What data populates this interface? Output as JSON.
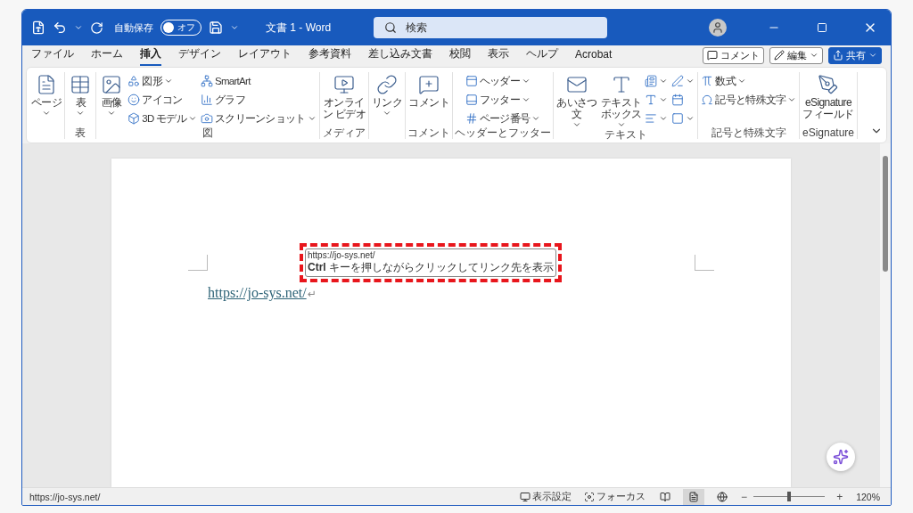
{
  "window": {
    "title": "文書 1 - Word",
    "autosave": {
      "label": "自動保存",
      "on": false,
      "state_text": "オフ"
    },
    "search": {
      "placeholder": "検索"
    }
  },
  "menu_tabs": [
    {
      "label": "ファイル",
      "selected": false
    },
    {
      "label": "ホーム",
      "selected": false
    },
    {
      "label": "挿入",
      "selected": true
    },
    {
      "label": "デザイン",
      "selected": false
    },
    {
      "label": "レイアウト",
      "selected": false
    },
    {
      "label": "参考資料",
      "selected": false
    },
    {
      "label": "差し込み文書",
      "selected": false
    },
    {
      "label": "校閲",
      "selected": false
    },
    {
      "label": "表示",
      "selected": false
    },
    {
      "label": "ヘルプ",
      "selected": false
    },
    {
      "label": "Acrobat",
      "selected": false
    }
  ],
  "action_buttons": [
    {
      "label": "コメント",
      "kind": "outline",
      "dropdown": false
    },
    {
      "label": "編集",
      "kind": "outline",
      "dropdown": true
    },
    {
      "label": "共有",
      "kind": "primary",
      "dropdown": true
    }
  ],
  "ribbon": {
    "groups": [
      {
        "columns": [
          [
            {
              "kind": "large",
              "label": "ページ",
              "dropdown": true
            }
          ]
        ]
      },
      {
        "label": "表",
        "columns": [
          [
            {
              "kind": "large",
              "label": "表",
              "dropdown": true
            }
          ]
        ]
      },
      {
        "label": "図",
        "columns": [
          [
            {
              "kind": "large",
              "label": "画像",
              "dropdown": true
            }
          ],
          [
            {
              "kind": "small",
              "label": "図形",
              "dropdown": true
            },
            {
              "kind": "small",
              "label": "アイコン",
              "dropdown": false
            },
            {
              "kind": "small",
              "label": "3D モデル",
              "dropdown": true
            }
          ],
          [
            {
              "kind": "small",
              "label": "SmartArt",
              "dropdown": false
            },
            {
              "kind": "small",
              "label": "グラフ",
              "dropdown": false
            },
            {
              "kind": "small",
              "label": "スクリーンショット",
              "dropdown": true
            }
          ]
        ]
      },
      {
        "label": "メディア",
        "columns": [
          [
            {
              "kind": "large",
              "lines": [
                "オンライ",
                "ン ビデオ"
              ],
              "dropdown": false
            }
          ]
        ]
      },
      {
        "columns": [
          [
            {
              "kind": "large",
              "label": "リンク",
              "dropdown": true
            }
          ]
        ]
      },
      {
        "label": "コメント",
        "columns": [
          [
            {
              "kind": "large",
              "label": "コメント",
              "dropdown": false
            }
          ]
        ]
      },
      {
        "label": "ヘッダーとフッター",
        "columns": [
          [
            {
              "kind": "small",
              "label": "ヘッダー",
              "dropdown": true
            },
            {
              "kind": "small",
              "label": "フッター",
              "dropdown": true
            },
            {
              "kind": "small",
              "label": "ページ番号",
              "dropdown": true
            }
          ]
        ]
      },
      {
        "label": "テキスト",
        "columns": [
          [
            {
              "kind": "large",
              "lines": [
                "あいさつ",
                "文"
              ],
              "dropdown": true
            }
          ],
          [
            {
              "kind": "large",
              "lines": [
                "テキスト",
                "ボックス"
              ],
              "dropdown": true
            }
          ],
          [
            {
              "kind": "small",
              "dropdown": true
            },
            {
              "kind": "small",
              "dropdown": true
            },
            {
              "kind": "small",
              "dropdown": true
            }
          ],
          [
            {
              "kind": "small",
              "dropdown": true
            },
            {
              "kind": "small",
              "dropdown": false
            },
            {
              "kind": "small",
              "dropdown": true
            }
          ]
        ]
      },
      {
        "label": "記号と特殊文字",
        "columns": [
          [
            {
              "kind": "small",
              "label": "数式",
              "dropdown": true
            },
            {
              "kind": "small",
              "label": "記号と特殊文字",
              "dropdown": true
            }
          ]
        ]
      },
      {
        "label": "eSignature",
        "columns": [
          [
            {
              "kind": "large",
              "lines": [
                "eSignature",
                "フィールド"
              ],
              "dropdown": false
            }
          ]
        ]
      }
    ]
  },
  "document": {
    "hyperlink": "https://jo-sys.net/",
    "paragraph_mark": "↵",
    "tooltip": {
      "url": "https://jo-sys.net/",
      "hint": "**Ctrl** キーを押しながらクリックしてリンク先を表示"
    }
  },
  "status_bar": {
    "text": "https://jo-sys.net/",
    "display_settings": "表示設定",
    "focus": "フォーカス",
    "views": [
      {
        "selected": false
      },
      {
        "selected": true
      },
      {
        "selected": false
      }
    ],
    "zoom": {
      "minus": "−",
      "plus": "+",
      "level": 0.5,
      "reading": "120%"
    }
  }
}
